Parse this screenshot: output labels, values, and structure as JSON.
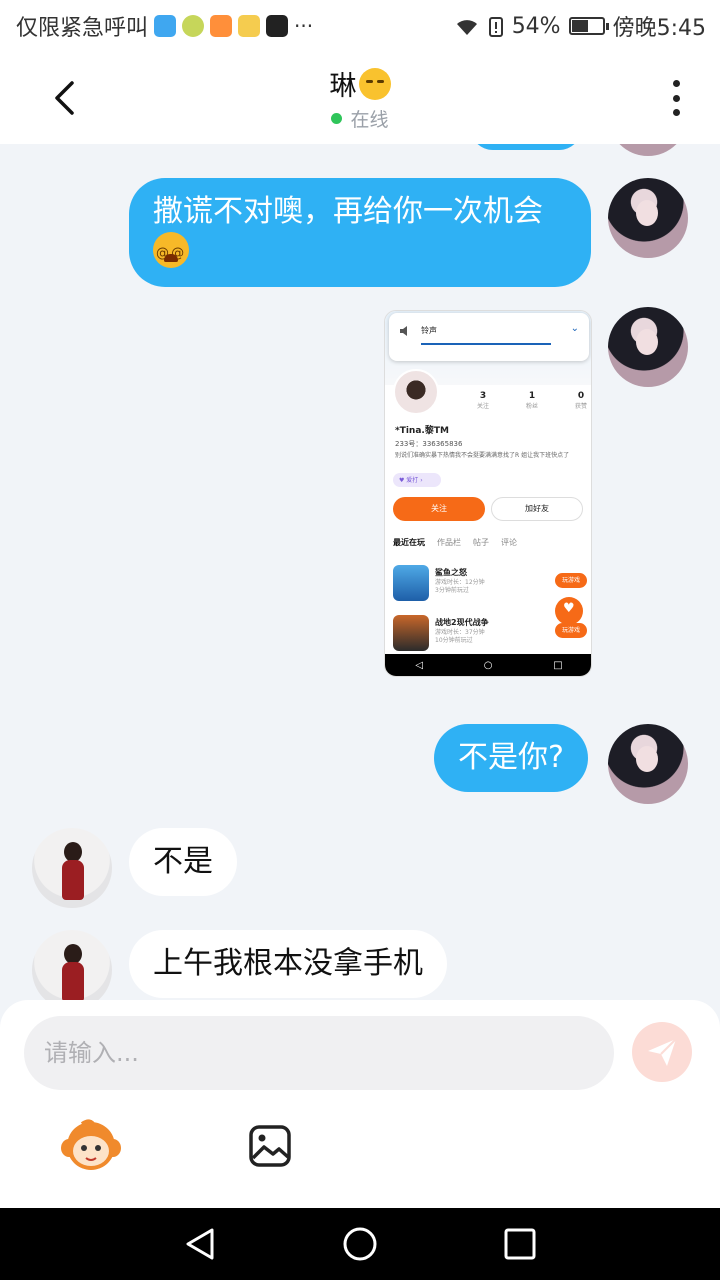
{
  "status_bar": {
    "carrier": "仅限紧急呼叫",
    "battery_percent": "54%",
    "battery_level": 0.54,
    "time": "傍晚5:45"
  },
  "header": {
    "title": "琳",
    "title_emoji": "unamused-face-emoji",
    "status": "在线",
    "status_color": "#2fc55a"
  },
  "messages": [
    {
      "from": "me",
      "text": "撒谎不对噢，再给你一次机会",
      "emoji": "dizzy-face-emoji"
    },
    {
      "from": "me",
      "type": "image"
    },
    {
      "from": "me",
      "text": "不是你?"
    },
    {
      "from": "her",
      "text": "不是"
    },
    {
      "from": "her",
      "text": "上午我根本没拿手机"
    }
  ],
  "screenshot": {
    "volume_label": "铃声",
    "stats": [
      {
        "value": "3",
        "label": "关注"
      },
      {
        "value": "1",
        "label": "粉丝"
      },
      {
        "value": "0",
        "label": "获赞"
      }
    ],
    "name": "*Tina.黎TM",
    "id_line": "233号：336365836",
    "bio": "别说们准确实暴下热情我不会挺要满满意找了R 姐让我下班快点了",
    "tag": "爱打",
    "follow": "关注",
    "add_friend": "加好友",
    "tabs": [
      "最近在玩",
      "作品栏",
      "帖子",
      "评论"
    ],
    "games": [
      {
        "name": "鲨鱼之怒",
        "meta1": "游戏时长：12分钟",
        "meta2": "3分钟前玩过",
        "button": "玩游戏"
      },
      {
        "name": "战地2现代战争",
        "meta1": "游戏时长：37分钟",
        "meta2": "10分钟前玩过",
        "button": "玩游戏"
      }
    ],
    "nav": [
      "◁",
      "○",
      "□"
    ]
  },
  "composer": {
    "placeholder": "请输入...",
    "accent": "#f66a17"
  },
  "colors": {
    "my_bubble": "#2fb1f4",
    "background": "#f1f4f8"
  }
}
